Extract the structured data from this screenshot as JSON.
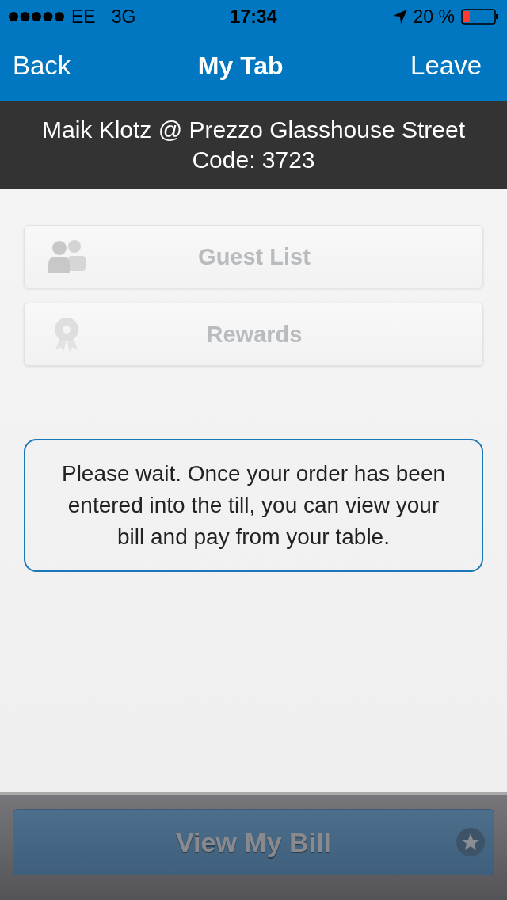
{
  "status_bar": {
    "carrier": "EE",
    "network": "3G",
    "time": "17:34",
    "battery": "20 %"
  },
  "nav": {
    "back": "Back",
    "title": "My Tab",
    "action": "Leave"
  },
  "header": {
    "line_1": "Maik Klotz @ Prezzo Glasshouse Street",
    "line_2": "Code: 3723"
  },
  "menu": [
    {
      "kind": "guests",
      "label": "Guest List",
      "disabled": true
    },
    {
      "kind": "rewards",
      "label": "Rewards",
      "disabled": true
    }
  ],
  "notice": "Please wait. Once your order has been entered into the till, you can view your bill and pay from your table.",
  "bill_button": {
    "label": "View My Bill",
    "disabled": true
  }
}
